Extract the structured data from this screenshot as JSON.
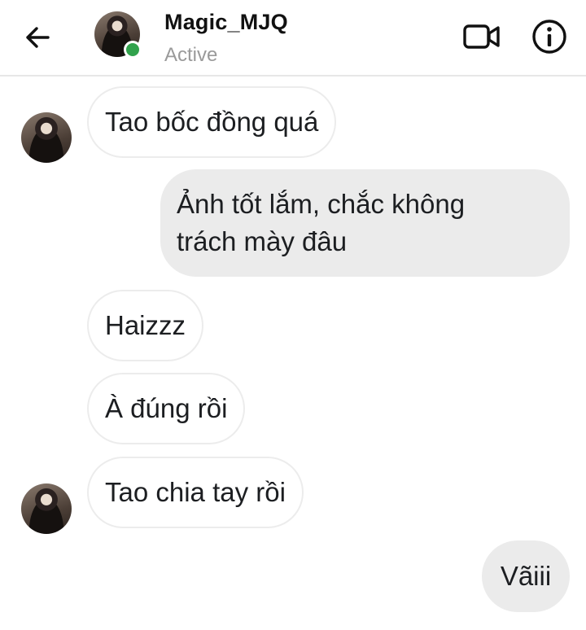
{
  "header": {
    "contact_name": "Magic_MJQ",
    "status": "Active",
    "online_color": "#31a24c",
    "icons": [
      "back-arrow-icon",
      "video-call-icon",
      "info-icon"
    ]
  },
  "messages": [
    {
      "direction": "incoming",
      "text": "Tao bốc đồng quá",
      "show_avatar": true
    },
    {
      "direction": "outgoing",
      "line1": "Ảnh tốt lắm, chắc không",
      "line2": "trách mày đâu"
    },
    {
      "direction": "incoming",
      "text": "Haizzz",
      "show_avatar": false
    },
    {
      "direction": "incoming",
      "text": "À đúng rồi",
      "show_avatar": false
    },
    {
      "direction": "incoming",
      "text": "Tao chia tay rồi",
      "show_avatar": true
    },
    {
      "direction": "outgoing",
      "text": "Vãiii"
    }
  ],
  "colors": {
    "outgoing_bubble": "#ebebeb",
    "incoming_bubble": "#ffffff",
    "status_text": "#9a9a9a"
  }
}
